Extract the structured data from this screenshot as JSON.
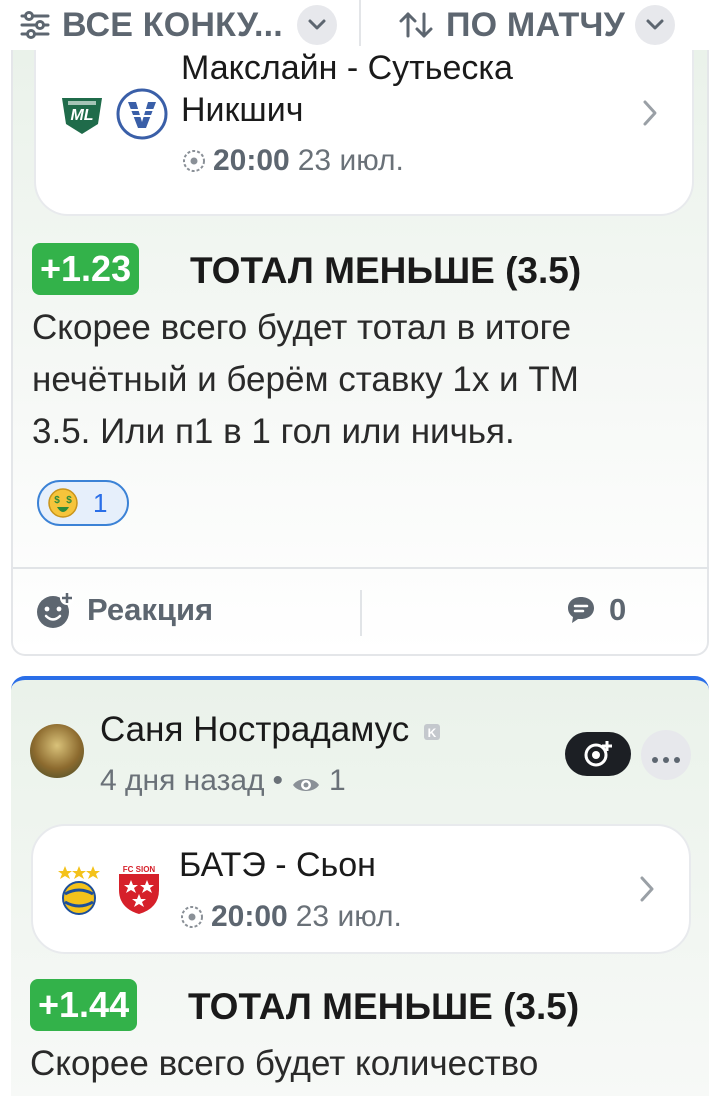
{
  "filters": {
    "competition_label": "ВСЕ КОНКУ...",
    "sort_label": "ПО МАТЧУ"
  },
  "posts": [
    {
      "match": {
        "title": "Макслайн - Сутьеска Никшич",
        "title_line1": "Макслайн - Сутьеска",
        "title_line2": "Никшич",
        "time": "20:00",
        "date": "23 июл."
      },
      "odds": "+1.23",
      "bet": "ТОТАЛ МЕНЬШЕ (3.5)",
      "comment_lines": [
        "Скорее всего будет тотал в итоге",
        "нечётный и берём ставку 1х и ТМ",
        "3.5. Или п1 в 1 гол или ничья."
      ],
      "reaction_count": "1",
      "actions": {
        "reaction_label": "Реакция",
        "comments_count": "0"
      }
    },
    {
      "author": {
        "name": "Саня Нострадамус",
        "time_ago": "4 дня назад",
        "views": "1"
      },
      "match": {
        "title": "БАТЭ - Сьон",
        "time": "20:00",
        "date": "23 июл."
      },
      "odds": "+1.44",
      "bet": "ТОТАЛ МЕНЬШЕ (3.5)",
      "comment_lines": [
        "Скорее всего будет количество"
      ]
    }
  ],
  "colors": {
    "odds_badge": "#33b24a",
    "accent_blue": "#2a6ee8",
    "follow_btn": "#1c1f24"
  },
  "icons": [
    "filter-icon",
    "chevron-down-icon",
    "sort-icon",
    "chevron-right-icon",
    "soccer-ball-icon",
    "money-face-emoji",
    "add-reaction-icon",
    "comment-icon",
    "eye-icon",
    "subscribe-icon",
    "more-icon"
  ]
}
